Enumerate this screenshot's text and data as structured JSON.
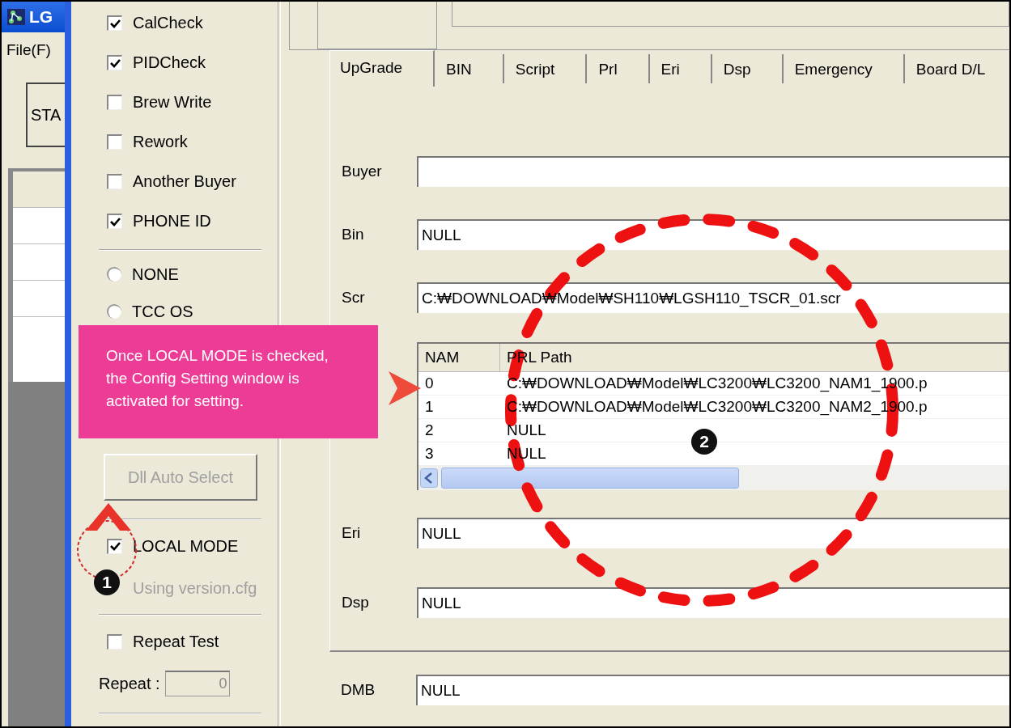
{
  "main_window": {
    "title": "LG",
    "menu": [
      "File(F)"
    ],
    "button": "STA"
  },
  "options": {
    "checkboxes": [
      {
        "label": "CalCheck",
        "checked": true
      },
      {
        "label": "PIDCheck",
        "checked": true
      },
      {
        "label": "Brew Write",
        "checked": false
      },
      {
        "label": "Rework",
        "checked": false
      },
      {
        "label": "Another Buyer",
        "checked": false
      },
      {
        "label": "PHONE ID",
        "checked": true
      }
    ],
    "radios": [
      {
        "label": "NONE",
        "selected": false
      },
      {
        "label": "TCC OS",
        "selected": false
      }
    ],
    "buttons": [
      {
        "label": "Dll Auto Select",
        "disabled": true
      }
    ],
    "local_mode": {
      "label": "LOCAL MODE",
      "checked": true
    },
    "using_version": {
      "label": "Using version.cfg",
      "disabled": true
    },
    "repeat_test": {
      "label": "Repeat Test",
      "checked": false
    },
    "repeat": {
      "label": "Repeat :",
      "value": "0"
    }
  },
  "tabs": [
    {
      "label": "UpGrade",
      "selected": true
    },
    {
      "label": "BIN",
      "selected": false
    },
    {
      "label": "Script",
      "selected": false
    },
    {
      "label": "Prl",
      "selected": false
    },
    {
      "label": "Eri",
      "selected": false
    },
    {
      "label": "Dsp",
      "selected": false
    },
    {
      "label": "Emergency",
      "selected": false
    },
    {
      "label": "Board D/L",
      "selected": false
    }
  ],
  "fields": [
    {
      "label": "Buyer"
    },
    {
      "label": "Bin",
      "value": "NULL"
    },
    {
      "label": "Scr",
      "value": "C:₩DOWNLOAD₩Model₩SH110₩LGSH110_TSCR_01.scr"
    }
  ],
  "prl_table": {
    "columns": [
      "NAM",
      "PRL Path"
    ],
    "rows": [
      [
        "0",
        "C:₩DOWNLOAD₩Model₩LC3200₩LC3200_NAM1_1900.p"
      ],
      [
        "1",
        "C:₩DOWNLOAD₩Model₩LC3200₩LC3200_NAM2_1900.p"
      ],
      [
        "2",
        "NULL"
      ],
      [
        "3",
        "NULL"
      ]
    ]
  },
  "fields_after": [
    {
      "label": "Eri",
      "value": "NULL"
    },
    {
      "label": "Dsp",
      "value": "NULL"
    }
  ],
  "dmb": {
    "label": "DMB",
    "value": "NULL"
  },
  "annotations": {
    "callout": "Once LOCAL MODE is checked, the Config Setting window is activated for setting.",
    "badges": [
      "1",
      "2"
    ]
  }
}
